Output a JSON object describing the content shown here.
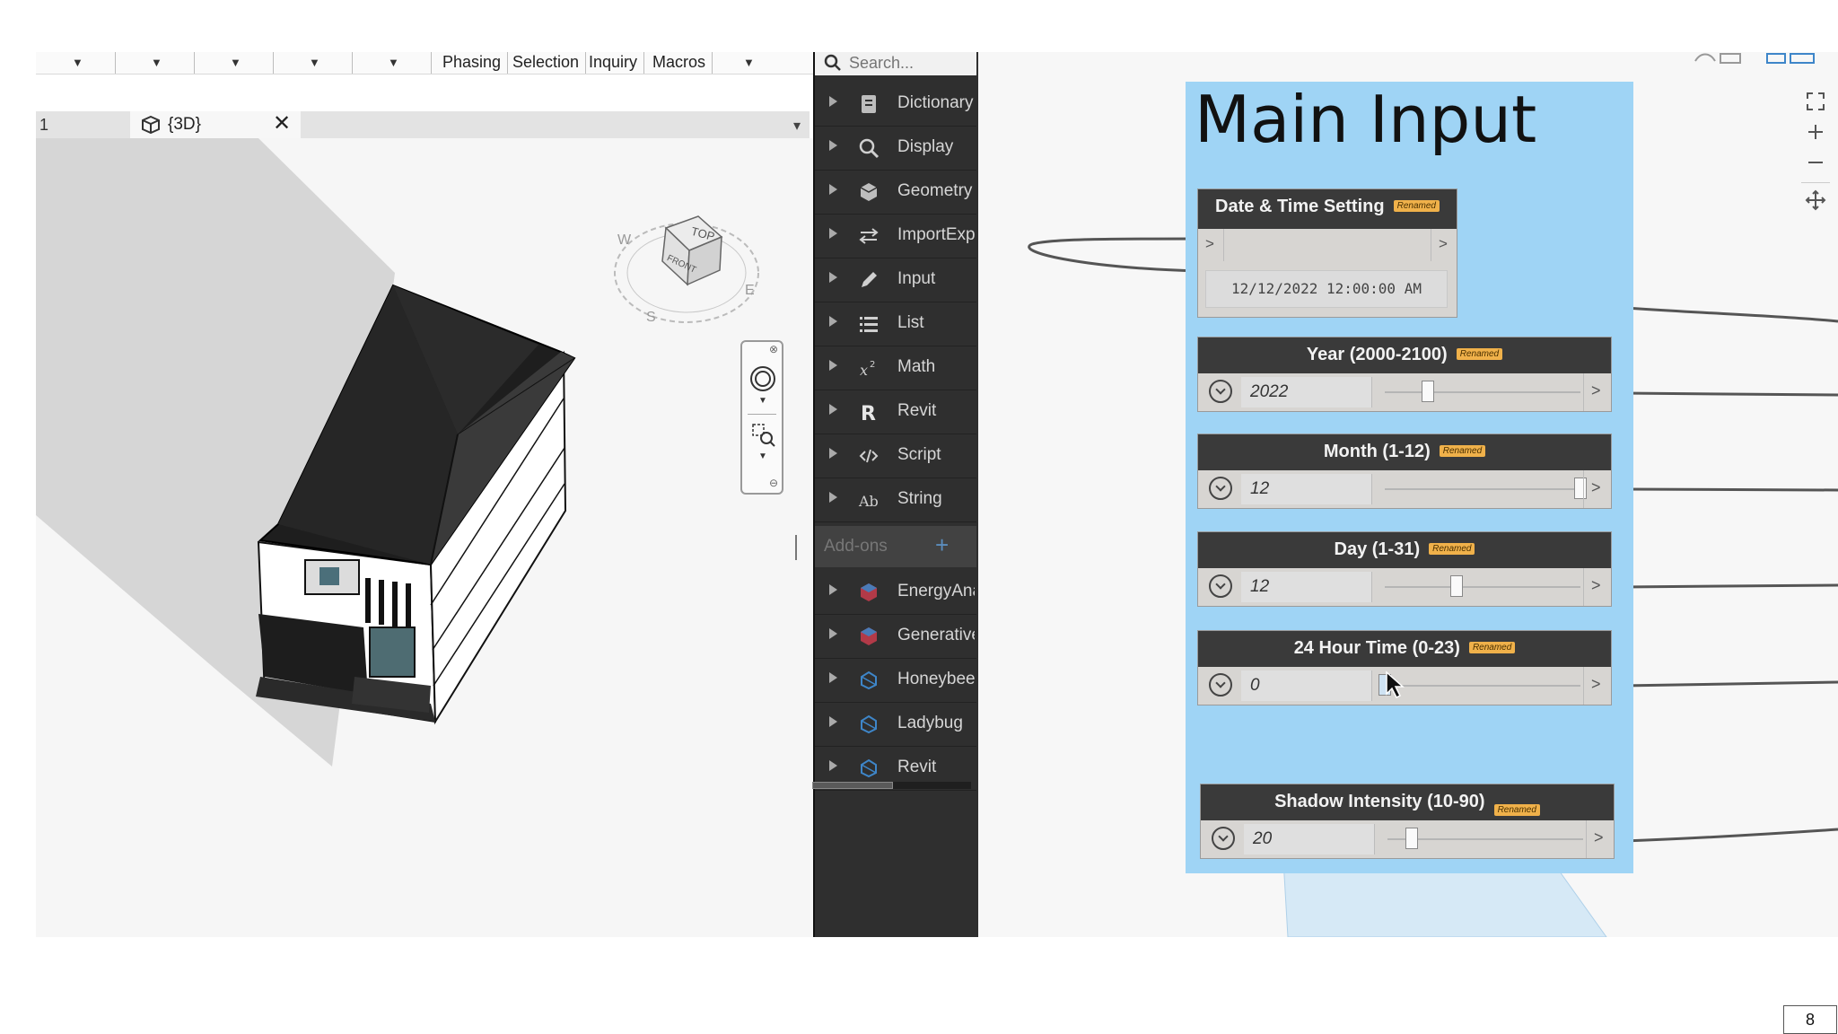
{
  "revit": {
    "ribbon_tabs": [
      "Phasing",
      "Selection",
      "Inquiry",
      "Macros"
    ],
    "view_tabs": {
      "index_label": "1",
      "active_label": "{3D}"
    },
    "viewcube": {
      "top": "TOP",
      "front": "FRONT",
      "west": "W",
      "south": "S",
      "east": "E"
    }
  },
  "library": {
    "search_placeholder": "Search...",
    "items": [
      {
        "label": "Dictionary",
        "icon": "dictionary-icon"
      },
      {
        "label": "Display",
        "icon": "display-magnifier-icon"
      },
      {
        "label": "Geometry",
        "icon": "geometry-cube-icon"
      },
      {
        "label": "ImportExport",
        "icon": "import-export-arrows-icon"
      },
      {
        "label": "Input",
        "icon": "input-pencil-icon"
      },
      {
        "label": "List",
        "icon": "list-icon"
      },
      {
        "label": "Math",
        "icon": "math-x-squared-icon"
      },
      {
        "label": "Revit",
        "icon": "revit-r-icon"
      },
      {
        "label": "Script",
        "icon": "script-code-icon"
      },
      {
        "label": "String",
        "icon": "string-ab-icon"
      }
    ],
    "addons_label": "Add-ons",
    "addon_items": [
      {
        "label": "EnergyAnalysis",
        "icon": "package-red-icon"
      },
      {
        "label": "Generative",
        "icon": "package-red-icon"
      },
      {
        "label": "Honeybee",
        "icon": "package-blue-icon"
      },
      {
        "label": "Ladybug",
        "icon": "package-blue-icon"
      },
      {
        "label": "Revit",
        "icon": "package-blue-icon"
      }
    ]
  },
  "canvas": {
    "group_title": "Main Input",
    "renamed_badge": "Renamed",
    "datetime_node": {
      "title": "Date & Time Setting",
      "value": "12/12/2022 12:00:00 AM"
    },
    "sliders": [
      {
        "id": "year",
        "title": "Year (2000-2100)",
        "value": "2022",
        "min": 2000,
        "max": 2100,
        "val": 2022
      },
      {
        "id": "month",
        "title": "Month (1-12)",
        "value": "12",
        "min": 1,
        "max": 12,
        "val": 12
      },
      {
        "id": "day",
        "title": "Day (1-31)",
        "value": "12",
        "min": 1,
        "max": 31,
        "val": 12
      },
      {
        "id": "hour",
        "title": "24 Hour Time (0-23)",
        "value": "0",
        "min": 0,
        "max": 23,
        "val": 0
      },
      {
        "id": "shadow",
        "title": "Shadow Intensity (10-90)",
        "value": "20",
        "min": 10,
        "max": 90,
        "val": 20
      }
    ],
    "port_symbol": ">"
  },
  "footer": {
    "page_number": "8"
  },
  "colors": {
    "group_bg": "#9fd4f5",
    "node_header": "#3a3a3a",
    "badge": "#f0b14a",
    "library_bg": "#2f2f2f"
  }
}
